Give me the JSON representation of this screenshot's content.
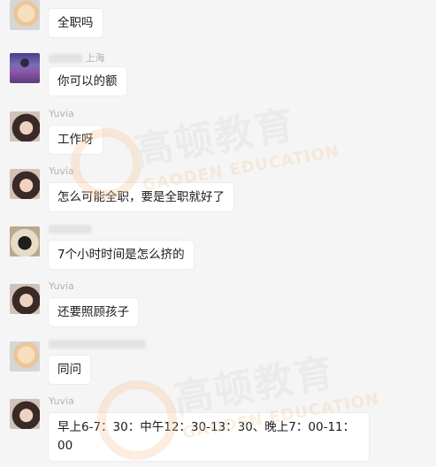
{
  "messages": [
    {
      "sender": "",
      "sender_blurred": true,
      "avatar": "baby-avatar",
      "text": "全职吗"
    },
    {
      "sender": "上海",
      "sender_blurred": true,
      "avatar": "lavender-avatar",
      "text": "你可以的额"
    },
    {
      "sender": "Yuvia",
      "avatar": "girl-avatar",
      "text": "工作呀"
    },
    {
      "sender": "Yuvia",
      "avatar": "girl-avatar",
      "text": "怎么可能全职，要是全职就好了"
    },
    {
      "sender": "",
      "sender_blurred": true,
      "avatar": "dog-avatar",
      "text": "7个小时时间是怎么挤的"
    },
    {
      "sender": "Yuvia",
      "avatar": "girl-avatar",
      "text": "还要照顾孩子"
    },
    {
      "sender": "",
      "sender_blurred": true,
      "avatar": "baby-avatar",
      "text": "同问"
    },
    {
      "sender": "Yuvia",
      "avatar": "girl-avatar",
      "text": "早上6-7：30：中午12：30-13：30、晚上7：00-11：00"
    }
  ],
  "watermark": {
    "brand": "高顿教育",
    "sub": "GAODEN EDUCATION"
  },
  "colors": {
    "background": "#f5f5f5",
    "bubble": "#ffffff",
    "name": "#b2b2b2"
  }
}
